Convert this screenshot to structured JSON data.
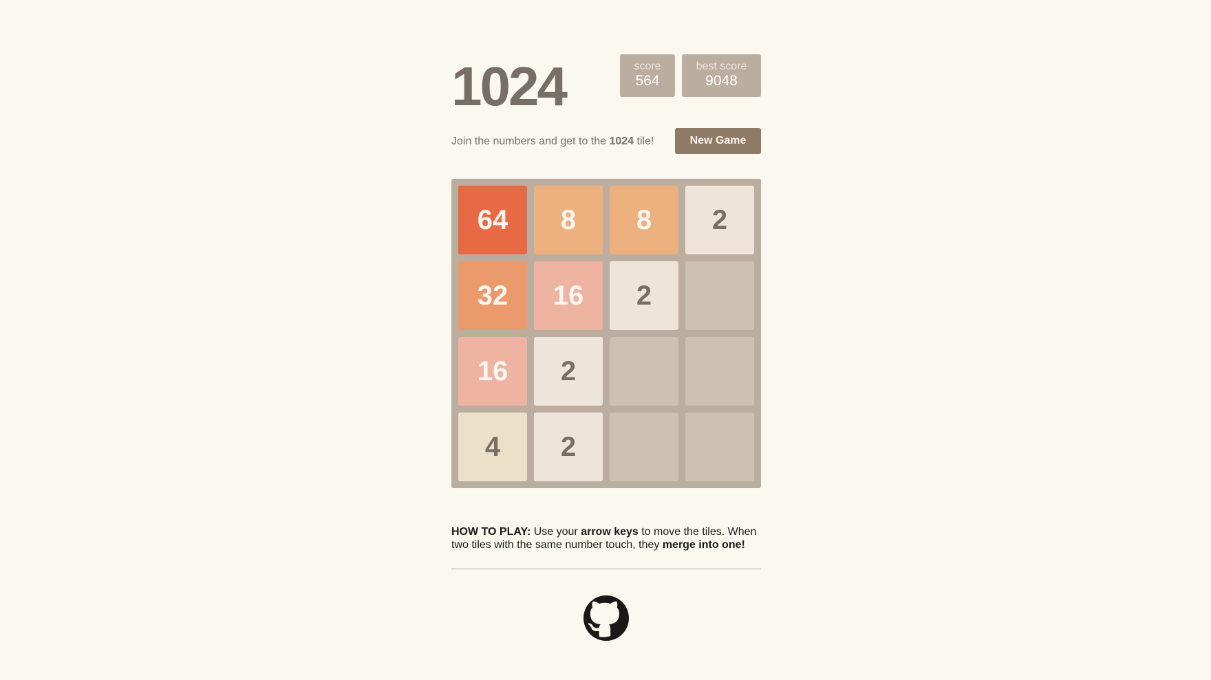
{
  "header": {
    "title": "1024",
    "score_label": "score",
    "score_value": "564",
    "best_label": "best score",
    "best_value": "9048"
  },
  "intro": {
    "prefix": "Join the numbers and get to the ",
    "goal": "1024",
    "suffix": " tile!"
  },
  "new_game_label": "New Game",
  "board": {
    "rows": [
      [
        "64",
        "8",
        "8",
        "2"
      ],
      [
        "32",
        "16",
        "2",
        ""
      ],
      [
        "16",
        "2",
        "",
        ""
      ],
      [
        "4",
        "2",
        "",
        ""
      ]
    ]
  },
  "tile_colors": {
    "empty": {
      "bg": "#cdc1b4",
      "fg": "#776e65"
    },
    "2": {
      "bg": "#eee4da",
      "fg": "#776e65"
    },
    "4": {
      "bg": "#ede0c8",
      "fg": "#776e65"
    },
    "8": {
      "bg": "#ecb17f",
      "fg": "#f9f6f2"
    },
    "16": {
      "bg": "#efb3a2",
      "fg": "#f9f6f2"
    },
    "32": {
      "bg": "#eb9b6b",
      "fg": "#f9f6f2"
    },
    "64": {
      "bg": "#e86a44",
      "fg": "#f9f6f2"
    }
  },
  "instructions": {
    "heading": "HOW TO PLAY:",
    "part1": " Use your ",
    "arrow_keys": "arrow keys",
    "part2": " to move the tiles. When two tiles with the same number touch, they ",
    "merge": "merge into one!"
  },
  "footer": {
    "icon": "github-icon"
  }
}
